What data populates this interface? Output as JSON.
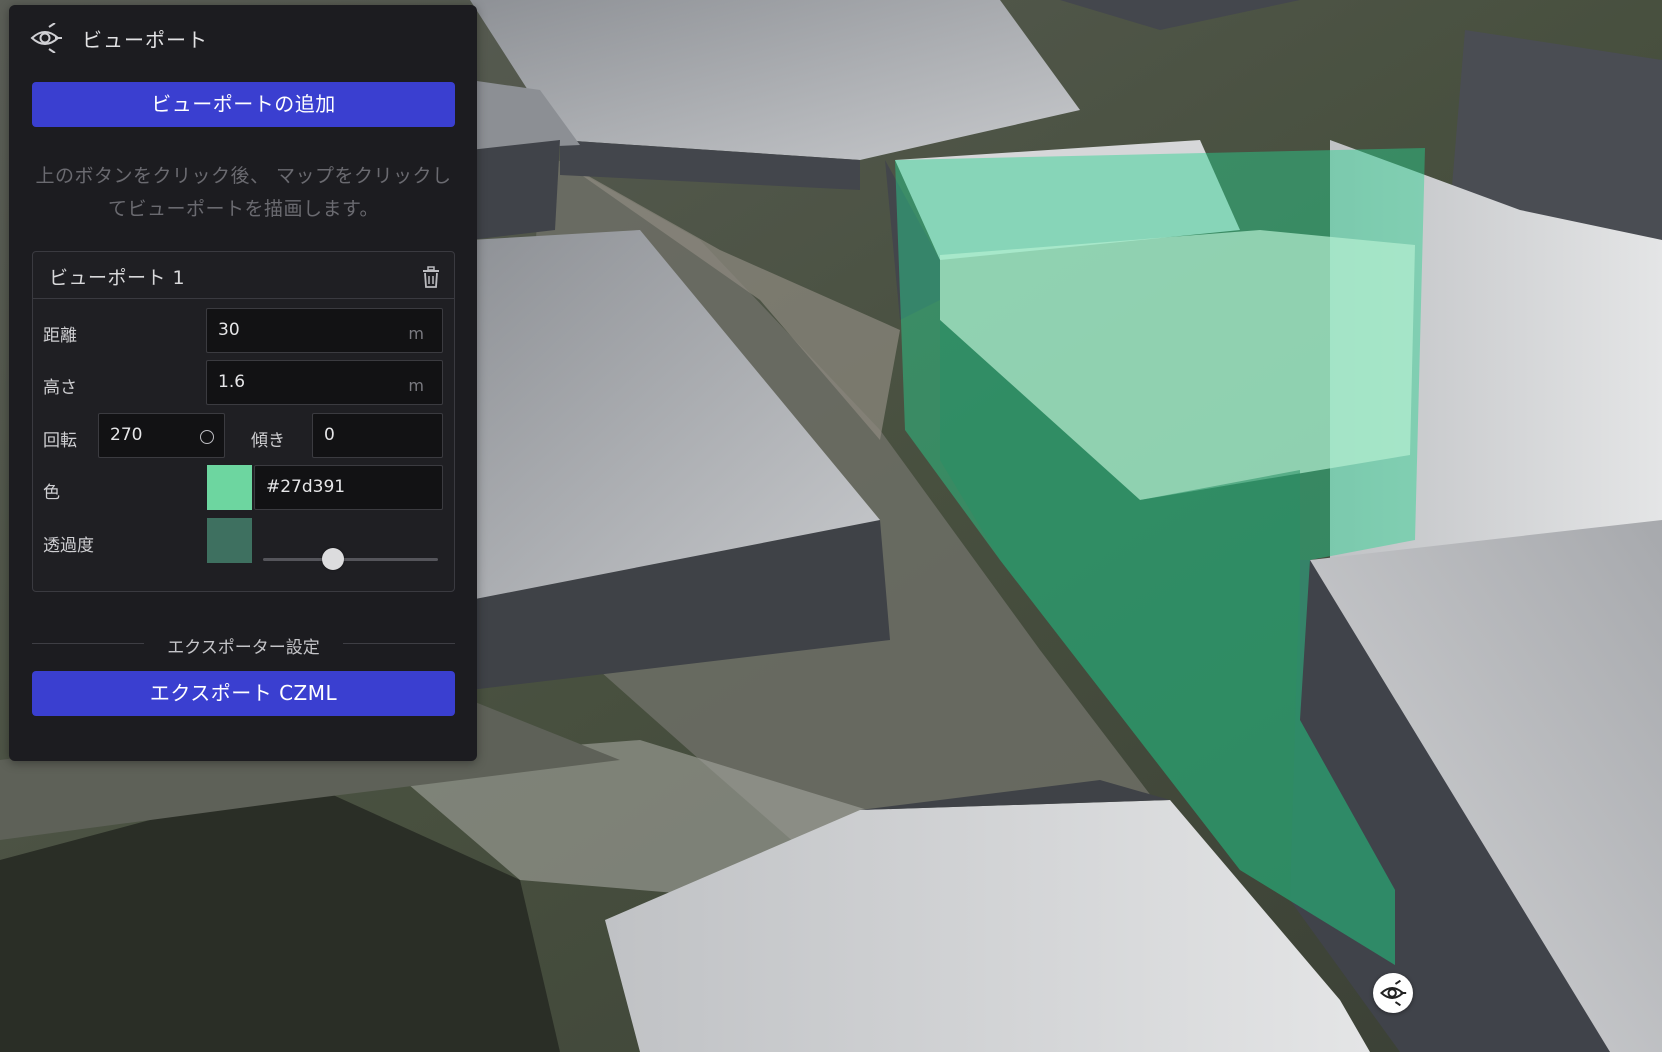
{
  "panel": {
    "title": "ビューポート",
    "icon": "viewport-eye-icon",
    "add_button_label": "ビューポートの追加",
    "hint": "上のボタンをクリック後、 マップをクリックしてビューポートを描画します。"
  },
  "viewport_card": {
    "title": "ビューポート 1",
    "delete_icon": "trash-icon",
    "distance": {
      "label": "距離",
      "value": "30",
      "unit": "m"
    },
    "height": {
      "label": "高さ",
      "value": "1.6",
      "unit": "m"
    },
    "rotation": {
      "label": "回転",
      "value": "270"
    },
    "tilt": {
      "label": "傾き",
      "value": "0"
    },
    "color": {
      "label": "色",
      "value": "#27d391",
      "swatch": "#6dd6a0"
    },
    "opacity": {
      "label": "透過度",
      "swatch": "#3e7060",
      "level_fraction": 0.4
    }
  },
  "exporter": {
    "section_label": "エクスポーター設定",
    "export_button_label": "エクスポート CZML"
  },
  "map": {
    "marker_icon": "viewport-eye-icon",
    "viewport_volume_color": "#27d391"
  }
}
